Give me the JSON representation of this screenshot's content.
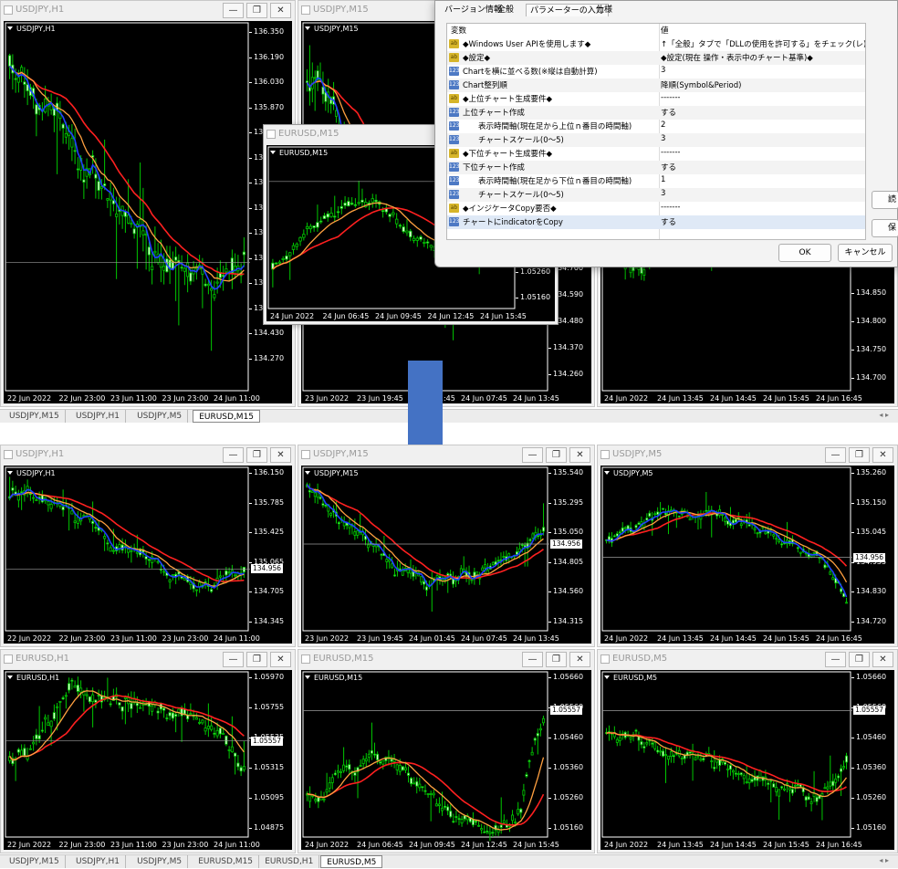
{
  "top_windows": [
    {
      "id": "w1",
      "title": "USDJPY,H1",
      "label": "USDJPY,H1",
      "yticks": [
        "136.350",
        "136.190",
        "136.030",
        "135.870",
        "135.710",
        "135.550",
        "135.390",
        "135.230",
        "135.070",
        "134.910",
        "134.750",
        "134.590",
        "134.430",
        "134.270"
      ],
      "xticks": [
        "22 Jun 2022",
        "22 Jun 23:00",
        "23 Jun 11:00",
        "23 Jun 23:00",
        "24 Jun 11:00"
      ]
    },
    {
      "id": "w2",
      "title": "USDJPY,M15",
      "label": "USDJPY,M15",
      "yticks": [
        "134.700",
        "134.590",
        "134.480",
        "134.370",
        "134.260"
      ],
      "xticks": [
        "23 Jun 2022",
        "23 Jun 19:45",
        "24 Jun 01:45",
        "24 Jun 07:45",
        "24 Jun 13:45"
      ]
    },
    {
      "id": "w3",
      "title": "USDJPY,M5",
      "label": "USDJPY,M5",
      "yticks": [
        "134.850",
        "134.800",
        "134.750",
        "134.700"
      ],
      "xticks": [
        "24 Jun 2022",
        "24 Jun 13:45",
        "24 Jun 14:45",
        "24 Jun 15:45",
        "24 Jun 16:45"
      ]
    }
  ],
  "floating_window": {
    "title": "EURUSD,M15",
    "label": "EURUSD,M15",
    "yticks": [
      "1.05260",
      "1.05160"
    ],
    "xticks": [
      "24 Jun 2022",
      "24 Jun 06:45",
      "24 Jun 09:45",
      "24 Jun 12:45",
      "24 Jun 15:45"
    ]
  },
  "top_tabs": [
    "USDJPY,M15",
    "USDJPY,H1",
    "USDJPY,M5",
    "EURUSD,M15"
  ],
  "top_tabs_active": 3,
  "window_buttons": {
    "minimize": "—",
    "restore": "❐",
    "close": "✕"
  },
  "dialog": {
    "tabs": [
      "バージョン情報",
      "全般",
      "パラメーターの入力",
      "仕様"
    ],
    "active_tab": 2,
    "headers": {
      "var": "変数",
      "val": "値"
    },
    "rows": [
      {
        "icon": "ab",
        "var": "◆Windows User APIを使用します◆",
        "val": "↑「全般」タブで「DLLの使用を許可する」をチェック(レ)してくだ..."
      },
      {
        "icon": "ab",
        "var": "◆設定◆",
        "val": "◆設定(現在 操作・表示中のチャート基準)◆"
      },
      {
        "icon": "123",
        "var": "Chartを横に並べる数(※縦は自動計算)",
        "val": "3"
      },
      {
        "icon": "123",
        "var": "Chart整列順",
        "val": "降順(Symbol&Period)"
      },
      {
        "icon": "ab",
        "var": "◆上位チャート生成要件◆",
        "val": "-------"
      },
      {
        "icon": "123",
        "var": "上位チャート作成",
        "val": "する"
      },
      {
        "icon": "123",
        "var": "　　表示時間軸(現在足から上位ｎ番目の時間軸)",
        "val": "2"
      },
      {
        "icon": "123",
        "var": "　　チャートスケール(0～5)",
        "val": "3"
      },
      {
        "icon": "ab",
        "var": "◆下位チャート生成要件◆",
        "val": "-------"
      },
      {
        "icon": "123",
        "var": "下位チャート作成",
        "val": "する"
      },
      {
        "icon": "123",
        "var": "　　表示時間軸(現在足から下位ｎ番目の時間軸)",
        "val": "1"
      },
      {
        "icon": "123",
        "var": "　　チャートスケール(0～5)",
        "val": "3"
      },
      {
        "icon": "ab",
        "var": "◆インジケータCopy要否◆",
        "val": "-------"
      },
      {
        "icon": "123",
        "var": "チャートにindicatorをCopy",
        "val": "する"
      }
    ],
    "ok": "OK",
    "cancel": "キャンセル",
    "side_btn1": "読",
    "side_btn2": "保"
  },
  "bottom_windows": [
    {
      "id": "b1",
      "title": "USDJPY,H1",
      "label": "USDJPY,H1",
      "yticks": [
        "136.150",
        "135.785",
        "135.425",
        "135.065",
        "134.705",
        "134.345"
      ],
      "price": "134.956",
      "xticks": [
        "22 Jun 2022",
        "22 Jun 23:00",
        "23 Jun 11:00",
        "23 Jun 23:00",
        "24 Jun 11:00"
      ]
    },
    {
      "id": "b2",
      "title": "USDJPY,M15",
      "label": "USDJPY,M15",
      "yticks": [
        "135.540",
        "135.295",
        "135.050",
        "134.805",
        "134.560",
        "134.315"
      ],
      "price": "134.956",
      "xticks": [
        "23 Jun 2022",
        "23 Jun 19:45",
        "24 Jun 01:45",
        "24 Jun 07:45",
        "24 Jun 13:45"
      ]
    },
    {
      "id": "b3",
      "title": "USDJPY,M5",
      "label": "USDJPY,M5",
      "yticks": [
        "135.260",
        "135.150",
        "135.045",
        "134.935",
        "134.830",
        "134.720"
      ],
      "price": "134.956",
      "xticks": [
        "24 Jun 2022",
        "24 Jun 13:45",
        "24 Jun 14:45",
        "24 Jun 15:45",
        "24 Jun 16:45"
      ]
    },
    {
      "id": "b4",
      "title": "EURUSD,H1",
      "label": "EURUSD,H1",
      "yticks": [
        "1.05970",
        "1.05755",
        "1.05535",
        "1.05315",
        "1.05095",
        "1.04875"
      ],
      "price": "1.05557",
      "xticks": [
        "22 Jun 2022",
        "22 Jun 23:00",
        "23 Jun 11:00",
        "23 Jun 23:00",
        "24 Jun 11:00"
      ]
    },
    {
      "id": "b5",
      "title": "EURUSD,M15",
      "label": "EURUSD,M15",
      "yticks": [
        "1.05660",
        "1.05560",
        "1.05460",
        "1.05360",
        "1.05260",
        "1.05160"
      ],
      "price": "1.05557",
      "xticks": [
        "24 Jun 2022",
        "24 Jun 06:45",
        "24 Jun 09:45",
        "24 Jun 12:45",
        "24 Jun 15:45"
      ]
    },
    {
      "id": "b6",
      "title": "EURUSD,M5",
      "label": "EURUSD,M5",
      "yticks": [
        "1.05660",
        "1.05560",
        "1.05460",
        "1.05360",
        "1.05260",
        "1.05160"
      ],
      "price": "1.05557",
      "xticks": [
        "24 Jun 2022",
        "24 Jun 13:45",
        "24 Jun 14:45",
        "24 Jun 15:45",
        "24 Jun 16:45"
      ]
    }
  ],
  "bottom_tabs": [
    "USDJPY,M15",
    "USDJPY,H1",
    "USDJPY,M5",
    "EURUSD,M15",
    "EURUSD,H1",
    "EURUSD,M5"
  ],
  "bottom_tabs_active": 5,
  "colors": {
    "candle_up": "#00c800",
    "candle_dn": "#00c800",
    "ma_red": "#ff2020",
    "ma_orange": "#ffa040",
    "ma_blue": "#2040ff",
    "bg": "#000000",
    "arrow": "#4472c4"
  }
}
